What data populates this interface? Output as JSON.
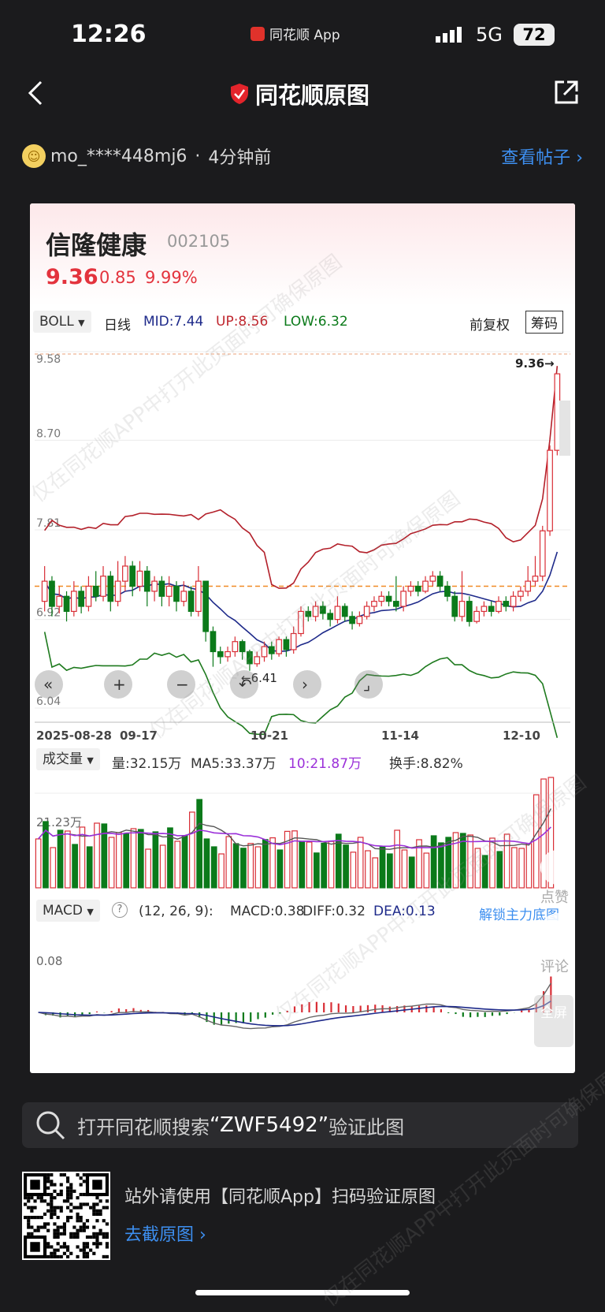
{
  "status_bar": {
    "time": "12:26",
    "app": "同花顺 App",
    "network": "5G",
    "battery": "72"
  },
  "nav": {
    "title": "同花顺原图"
  },
  "post": {
    "user": "mo_****448mj6",
    "sep": "·",
    "time_ago": "4分钟前",
    "view_post": "查看帖子"
  },
  "stock": {
    "name": "信隆健康",
    "code": "002105",
    "price": "9.36",
    "change": "0.85",
    "change_pct": "9.99%"
  },
  "boll_bar": {
    "indicator": "BOLL",
    "period": "日线",
    "mid": "MID:7.44",
    "up": "UP:8.56",
    "low": "LOW:6.32",
    "adjust": "前复权",
    "chips": "筹码"
  },
  "volume_bar": {
    "indicator": "成交量",
    "vol": "量:32.15万",
    "ma5": "MA5:33.37万",
    "ma10": "10:21.87万",
    "turnover": "换手:8.82%",
    "axis_label": "21.23万"
  },
  "macd_bar": {
    "indicator": "MACD",
    "params": "(12, 26, 9):",
    "macd": "MACD:0.38",
    "diff": "DIFF:0.32",
    "dea": "DEA:0.13",
    "unlock": "解锁主力底图",
    "axis_label": "0.08"
  },
  "floating": {
    "like": "点赞",
    "comment": "评论",
    "fullscreen": "全屏"
  },
  "search": {
    "prefix": "打开同花顺搜索",
    "code": "“ZWF5492”",
    "suffix": "验证此图"
  },
  "qr": {
    "text": "站外请使用【同花顺App】扫码验证原图",
    "link": "去截原图"
  },
  "watermark": "仅在同花顺APP中打开此页面时可确保原图",
  "colors": {
    "up": "#e3333d",
    "down": "#0b7a1a",
    "mid": "#1e2a8a",
    "link": "#3d8ff0",
    "ma10": "#9b30d9"
  },
  "chart_data": {
    "type": "candlestick",
    "title": "信隆健康 002105 日线",
    "price_axis_ticks": [
      "9.58",
      "8.70",
      "7.81",
      "6.92",
      "6.04"
    ],
    "date_ticks": [
      "2025-08-28",
      "09-17",
      "10-21",
      "11-14",
      "12-10"
    ],
    "last_price_marker": "9.36→",
    "min_price_marker": "6.41",
    "ylim": [
      6.04,
      9.58
    ],
    "boll": {
      "mid": 7.44,
      "up": 8.56,
      "low": 6.32
    },
    "candles": [
      {
        "o": 7.1,
        "c": 7.3,
        "h": 7.45,
        "l": 7.0
      },
      {
        "o": 7.3,
        "c": 7.05,
        "h": 7.35,
        "l": 6.95
      },
      {
        "o": 7.05,
        "c": 7.15,
        "h": 7.25,
        "l": 6.98
      },
      {
        "o": 7.15,
        "c": 7.0,
        "h": 7.2,
        "l": 6.9
      },
      {
        "o": 7.0,
        "c": 7.2,
        "h": 7.3,
        "l": 6.95
      },
      {
        "o": 7.2,
        "c": 7.05,
        "h": 7.25,
        "l": 6.98
      },
      {
        "o": 7.05,
        "c": 7.25,
        "h": 7.35,
        "l": 7.0
      },
      {
        "o": 7.25,
        "c": 7.15,
        "h": 7.4,
        "l": 7.1
      },
      {
        "o": 7.15,
        "c": 7.35,
        "h": 7.45,
        "l": 7.1
      },
      {
        "o": 7.35,
        "c": 7.1,
        "h": 7.4,
        "l": 7.0
      },
      {
        "o": 7.1,
        "c": 7.3,
        "h": 7.5,
        "l": 7.05
      },
      {
        "o": 7.3,
        "c": 7.45,
        "h": 7.55,
        "l": 7.2
      },
      {
        "o": 7.45,
        "c": 7.25,
        "h": 7.5,
        "l": 7.15
      },
      {
        "o": 7.25,
        "c": 7.4,
        "h": 7.5,
        "l": 7.2
      },
      {
        "o": 7.4,
        "c": 7.2,
        "h": 7.45,
        "l": 7.05
      },
      {
        "o": 7.2,
        "c": 7.3,
        "h": 7.35,
        "l": 7.1
      },
      {
        "o": 7.3,
        "c": 7.15,
        "h": 7.35,
        "l": 7.05
      },
      {
        "o": 7.15,
        "c": 7.25,
        "h": 7.35,
        "l": 7.05
      },
      {
        "o": 7.25,
        "c": 7.1,
        "h": 7.3,
        "l": 7.0
      },
      {
        "o": 7.1,
        "c": 7.2,
        "h": 7.3,
        "l": 7.05
      },
      {
        "o": 7.2,
        "c": 7.0,
        "h": 7.25,
        "l": 6.95
      },
      {
        "o": 7.0,
        "c": 7.3,
        "h": 7.45,
        "l": 6.95
      },
      {
        "o": 7.3,
        "c": 6.8,
        "h": 7.3,
        "l": 6.7
      },
      {
        "o": 6.8,
        "c": 6.6,
        "h": 6.85,
        "l": 6.45
      },
      {
        "o": 6.6,
        "c": 6.55,
        "h": 6.65,
        "l": 6.48
      },
      {
        "o": 6.55,
        "c": 6.6,
        "h": 6.65,
        "l": 6.5
      },
      {
        "o": 6.6,
        "c": 6.7,
        "h": 6.75,
        "l": 6.55
      },
      {
        "o": 6.7,
        "c": 6.6,
        "h": 6.72,
        "l": 6.52
      },
      {
        "o": 6.6,
        "c": 6.48,
        "h": 6.62,
        "l": 6.41
      },
      {
        "o": 6.48,
        "c": 6.55,
        "h": 6.6,
        "l": 6.45
      },
      {
        "o": 6.55,
        "c": 6.65,
        "h": 6.7,
        "l": 6.5
      },
      {
        "o": 6.65,
        "c": 6.58,
        "h": 6.7,
        "l": 6.52
      },
      {
        "o": 6.58,
        "c": 6.72,
        "h": 6.75,
        "l": 6.55
      },
      {
        "o": 6.72,
        "c": 6.62,
        "h": 6.75,
        "l": 6.55
      },
      {
        "o": 6.62,
        "c": 6.78,
        "h": 6.85,
        "l": 6.58
      },
      {
        "o": 6.78,
        "c": 7.0,
        "h": 7.05,
        "l": 6.75
      },
      {
        "o": 7.0,
        "c": 6.95,
        "h": 7.05,
        "l": 6.9
      },
      {
        "o": 6.95,
        "c": 7.05,
        "h": 7.1,
        "l": 6.9
      },
      {
        "o": 7.05,
        "c": 6.98,
        "h": 7.1,
        "l": 6.92
      },
      {
        "o": 6.98,
        "c": 6.92,
        "h": 7.02,
        "l": 6.85
      },
      {
        "o": 6.92,
        "c": 7.05,
        "h": 7.15,
        "l": 6.88
      },
      {
        "o": 7.05,
        "c": 6.95,
        "h": 7.08,
        "l": 6.9
      },
      {
        "o": 6.95,
        "c": 6.88,
        "h": 7.0,
        "l": 6.82
      },
      {
        "o": 6.88,
        "c": 6.95,
        "h": 7.0,
        "l": 6.85
      },
      {
        "o": 6.95,
        "c": 7.05,
        "h": 7.1,
        "l": 6.92
      },
      {
        "o": 7.05,
        "c": 7.1,
        "h": 7.15,
        "l": 7.0
      },
      {
        "o": 7.1,
        "c": 7.15,
        "h": 7.2,
        "l": 7.05
      },
      {
        "o": 7.15,
        "c": 7.1,
        "h": 7.2,
        "l": 7.05
      },
      {
        "o": 7.1,
        "c": 7.05,
        "h": 7.35,
        "l": 7.0
      },
      {
        "o": 7.05,
        "c": 7.2,
        "h": 7.25,
        "l": 7.0
      },
      {
        "o": 7.2,
        "c": 7.25,
        "h": 7.3,
        "l": 7.15
      },
      {
        "o": 7.25,
        "c": 7.2,
        "h": 7.3,
        "l": 7.15
      },
      {
        "o": 7.2,
        "c": 7.3,
        "h": 7.35,
        "l": 7.18
      },
      {
        "o": 7.3,
        "c": 7.35,
        "h": 7.4,
        "l": 7.25
      },
      {
        "o": 7.35,
        "c": 7.25,
        "h": 7.4,
        "l": 7.2
      },
      {
        "o": 7.25,
        "c": 7.15,
        "h": 7.3,
        "l": 7.1
      },
      {
        "o": 7.15,
        "c": 6.95,
        "h": 7.2,
        "l": 6.9
      },
      {
        "o": 6.95,
        "c": 7.1,
        "h": 7.4,
        "l": 6.9
      },
      {
        "o": 7.1,
        "c": 6.9,
        "h": 7.15,
        "l": 6.85
      },
      {
        "o": 6.9,
        "c": 7.0,
        "h": 7.05,
        "l": 6.88
      },
      {
        "o": 7.0,
        "c": 7.05,
        "h": 7.1,
        "l": 6.95
      },
      {
        "o": 7.05,
        "c": 7.0,
        "h": 7.1,
        "l": 6.95
      },
      {
        "o": 7.0,
        "c": 7.1,
        "h": 7.15,
        "l": 6.98
      },
      {
        "o": 7.1,
        "c": 7.05,
        "h": 7.15,
        "l": 7.0
      },
      {
        "o": 7.05,
        "c": 7.15,
        "h": 7.2,
        "l": 7.0
      },
      {
        "o": 7.15,
        "c": 7.2,
        "h": 7.25,
        "l": 7.1
      },
      {
        "o": 7.2,
        "c": 7.3,
        "h": 7.45,
        "l": 7.15
      },
      {
        "o": 7.3,
        "c": 7.35,
        "h": 7.55,
        "l": 7.25
      },
      {
        "o": 7.35,
        "c": 7.8,
        "h": 7.85,
        "l": 7.3
      },
      {
        "o": 7.8,
        "c": 8.6,
        "h": 8.65,
        "l": 7.75
      },
      {
        "o": 8.6,
        "c": 9.36,
        "h": 9.36,
        "l": 8.55
      }
    ],
    "volume_series": [
      {
        "name": "MA5",
        "color": "#5b5b5b"
      },
      {
        "name": "MA10",
        "color": "#9b30d9"
      }
    ],
    "macd": {
      "macd": 0.38,
      "diff": 0.32,
      "dea": 0.13
    }
  }
}
